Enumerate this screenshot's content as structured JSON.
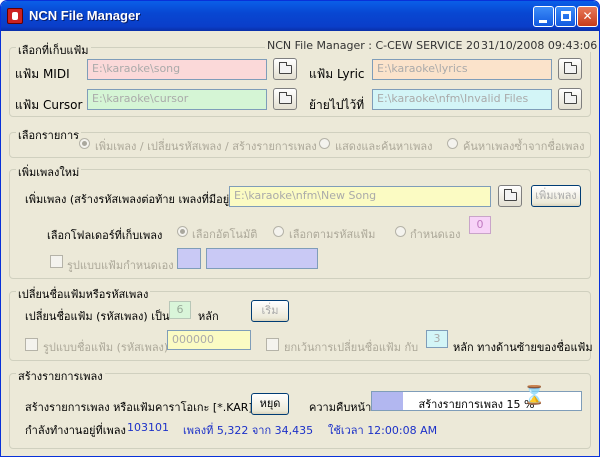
{
  "window": {
    "title": "NCN File Manager"
  },
  "header": {
    "service": "NCN File Manager : C-CEW SERVICE 2007",
    "datetime": "31/10/2008 09:43:06"
  },
  "folders": {
    "group_label": "เลือกที่เก็บแฟ้ม",
    "midi_label": "แฟ้ม MIDI",
    "midi_value": "E:\\karaoke\\song",
    "lyric_label": "แฟ้ม Lyric",
    "lyric_value": "E:\\karaoke\\lyrics",
    "cursor_label": "แฟ้ม Cursor",
    "cursor_value": "E:\\karaoke\\cursor",
    "move_label": "ย้ายไปไว้ที่",
    "move_value": "E:\\karaoke\\nfm\\Invalid Files"
  },
  "items": {
    "group_label": "เลือกรายการ",
    "option1": "เพิ่มเพลง / เปลี่ยนรหัสเพลง / สร้างรายการเพลง",
    "option2": "แสดงและค้นหาเพลง",
    "option3": "ค้นหาเพลงซ้ำจากชื่อเพลง"
  },
  "add_song": {
    "group_label": "เพิ่มเพลงใหม่",
    "label": "เพิ่มเพลง (สร้างรหัสเพลงต่อท้าย เพลงที่มีอยู่)",
    "path": "E:\\karaoke\\nfm\\New Song",
    "add_button": "เพิ่มเพลง",
    "folder_select_label": "เลือกโฟลเดอร์ที่เก็บเพลง",
    "auto": "เลือกอัตโนมัติ",
    "by_code": "เลือกตามรหัสแฟ้ม",
    "custom": "กำหนดเอง",
    "custom_value": "0",
    "custom_format_label": "รูปแบบแฟ้มกำหนดเอง"
  },
  "rename": {
    "group_label": "เปลี่ยนชื่อแฟ้มหรือรหัสเพลง",
    "label": "เปลี่ยนชื่อแฟ้ม (รหัสเพลง) เป็น",
    "digits": "6",
    "digits_unit": "หลัก",
    "start_button": "เริ่ม",
    "format_label": "รูปแบบชื่อแฟ้ม (รหัสเพลง)",
    "format_value": "000000",
    "except_label": "ยกเว้นการเปลี่ยนชื่อแฟ้ม กับ",
    "except_value": "3",
    "except_suffix": "หลัก ทางด้านซ้ายของชื่อแฟ้ม"
  },
  "build_list": {
    "group_label": "สร้างรายการเพลง",
    "label": "สร้างรายการเพลง หรือแฟ้มคาราโอเกะ [*.KAR]",
    "stop_button": "หยุด",
    "progress_label": "ความคืบหน้า",
    "progress_text": "สร้างรายการเพลง 15 %",
    "progress_fraction": 0.15
  },
  "status": {
    "working_label": "กำลังทำงานอยู่ที่เพลง",
    "working_value": "103101",
    "song_count": "เพลงที่ 5,322 จาก 34,435",
    "elapsed": "ใช้เวลา 12:00:08 AM"
  }
}
